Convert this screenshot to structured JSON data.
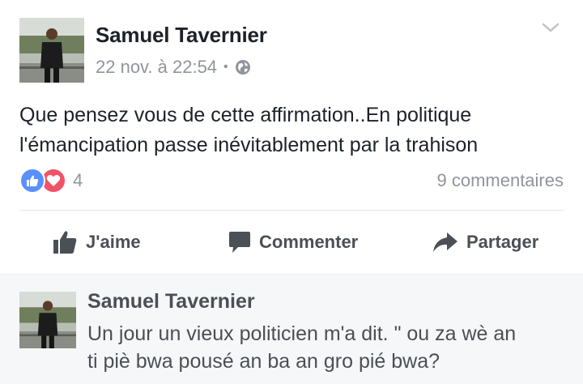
{
  "post": {
    "author": "Samuel Tavernier",
    "date": "22 nov. à 22:54",
    "separator": "•",
    "privacy_icon": "globe-icon",
    "text_line1": "Que pensez vous de cette affirmation..En politique",
    "text_line2": "l'émancipation passe inévitablement par la trahison",
    "reactions": {
      "icons": [
        "like-icon",
        "love-icon"
      ],
      "count": "4"
    },
    "comments_count": "9 commentaires"
  },
  "actions": {
    "like_label": "J'aime",
    "comment_label": "Commenter",
    "share_label": "Partager"
  },
  "comment": {
    "author": "Samuel Tavernier",
    "text_line1": "Un jour un vieux politicien m'a dit. \" ou za wè an",
    "text_line2": "ti piè bwa pousé  an ba an gro pié bwa?"
  },
  "colors": {
    "name_text": "#1d2129",
    "meta_text": "#90949c",
    "action_text": "#4b4f56",
    "like_blue": "#5890ff",
    "love_red": "#f25268",
    "comment_bg": "#f6f7f9"
  }
}
